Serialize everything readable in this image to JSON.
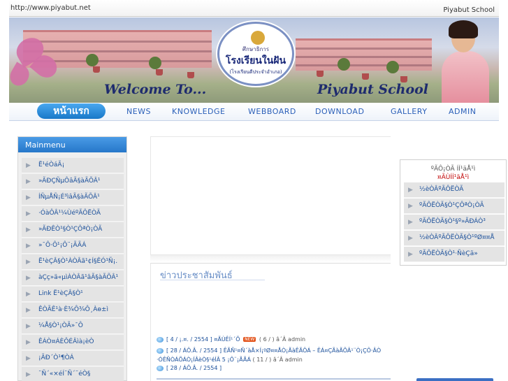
{
  "topbar": {
    "url": "http://www.piyabut.net",
    "site_name": "Piyabut School"
  },
  "banner": {
    "seal_line1": "ศึกษาธิการ",
    "seal_line2": "โรงเรียนในฝัน",
    "seal_line3": "(โรงเรียนดีประจำอำเภอ)",
    "welcome_left": "Welcome To...",
    "welcome_right": "Piyabut School"
  },
  "nav": {
    "home": "หน้าแรก",
    "items": [
      "NEWS",
      "KNOWLEDGE",
      "WEBBOARD",
      "DOWNLOAD",
      "GALLERY",
      "ADMIN"
    ]
  },
  "sidebar": {
    "title": "Mainmenu",
    "items": [
      "Ë¹éÒáÃ¡",
      "»ÃÐÇÑµÔâÃ§àÃÕÂ¹",
      "ÍÑµÅÑ¡É³ìâÃ§àÃÕÂ¹",
      "·ÓàÔÂ¹¼ÙéºÃÔËÒÃ",
      "»ÃÐÊÒ¹§Ò¹ÇÔªÒ¡ÒÃ",
      "»¯Ô·Ô¹¡Ô¨¡ÃÃÁ",
      "Ë¹èÇÂ§Ò¹ÀÒÂã¹¢Í§ÊÓ¹Ñ¡.",
      "àÇç»ä«µìÀÒÂã¹âÃ§àÃÕÂ¹",
      "Link Ë¹èÇÂ§Ò¹",
      "ÊÒÃÊ¹à·È¾Ô¾Ô¸Àѳ±ì",
      "¼Å§Ò¹¡ÒÃ»¯Ô",
      "ÊÁÒ¤ÁÈÔÉÂìà¡èÒ",
      "¡ÃÐ´Ò¹¶ÒÁ",
      "¨Ñ´«×éÍ¨Ñ´¨éÒ§"
    ]
  },
  "news": {
    "title": "ข่าวประชาสัมพันธ์",
    "items": [
      {
        "text": "[ 4 / ¡.¤. / 2554 ] ¤ÃÙÊÍ¹´Õ",
        "badge": "NEW",
        "meta": "( 6 / ) â´Â admin"
      },
      {
        "text": "[ 28 / ÁÔ.Â. / 2554 ] ÊÃÑ¹¤Ñ´àÅ×Í¡ºØ¤¤ÅÒ¡ÃàÊÃÔÁ – ÊÁ¤ÇÃàÃÕÂ¹¨Ò¡ÇÔ·ÂÒ",
        "text2": "·ÓÊÑ­­ÒÁÕÁÒ¡ÍÂèÒ§¹éÍÂ 5 ¡Ô¨¡ÃÃÁ",
        "meta": "( 11 / ) â´Â admin"
      },
      {
        "text": "[ 28 / ÁÔ.Â. / 2554 ]"
      }
    ]
  },
  "right": {
    "title1": "ºÃÔ¡ÒÃ ÍÍ¹äÅ¹ì",
    "title2": "¤ÃÙÍÍ¹äÅ¹ì",
    "items": [
      "½èÒÂºÃÔËÒÃ",
      "ºÃÔËÒÃ§Ò¹ÇÔªÒ¡ÒÃ",
      "ºÃÔËÒÃ§Ò¹§º»ÃÐÁÒ³",
      "½èÒÂºÃÔËÒÃ§Ò¹ºØ¤¤Å",
      "ºÃÔËÒÃ§Ò¹·ÑèÇä»"
    ]
  }
}
